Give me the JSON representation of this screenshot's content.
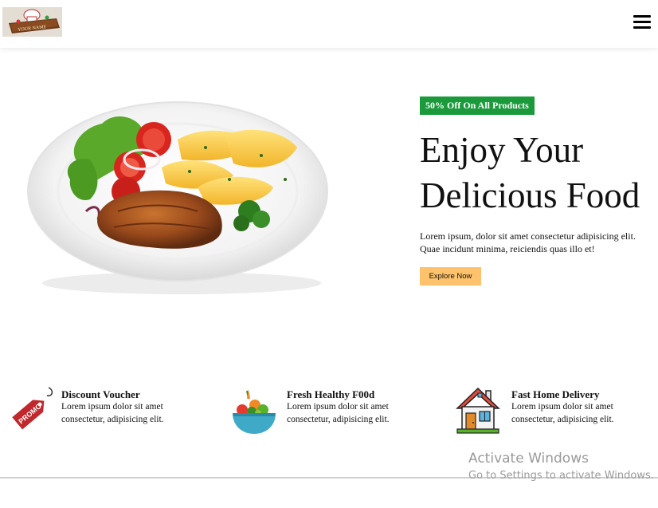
{
  "header": {
    "logo_text": "YOUR NAME",
    "menu_icon": "hamburger-icon"
  },
  "hero": {
    "badge": "50% Off On All Products",
    "title_line1": "Enjoy Your",
    "title_line2": "Delicious Food",
    "description": "Lorem ipsum, dolor sit amet consectetur adipisicing elit. Quae incidunt minima, reiciendis quas illo et!",
    "button_label": "Explore Now"
  },
  "features": [
    {
      "icon": "promo-tag-icon",
      "title": "Discount Voucher",
      "description": "Lorem ipsum dolor sit amet consectetur, adipisicing elit.",
      "icon_text": "PROMO"
    },
    {
      "icon": "vegetable-bowl-icon",
      "title": "Fresh Healthy F00d",
      "description": "Lorem ipsum dolor sit amet consectetur, adipisicing elit."
    },
    {
      "icon": "house-icon",
      "title": "Fast Home Delivery",
      "description": "Lorem ipsum dolor sit amet consectetur, adipisicing elit."
    }
  ],
  "watermark": {
    "title": "Activate Windows",
    "subtitle": "Go to Settings to activate Windows."
  },
  "colors": {
    "badge_bg": "#1b9a3c",
    "button_bg": "#fdc26b",
    "promo_tag": "#c0282d"
  }
}
